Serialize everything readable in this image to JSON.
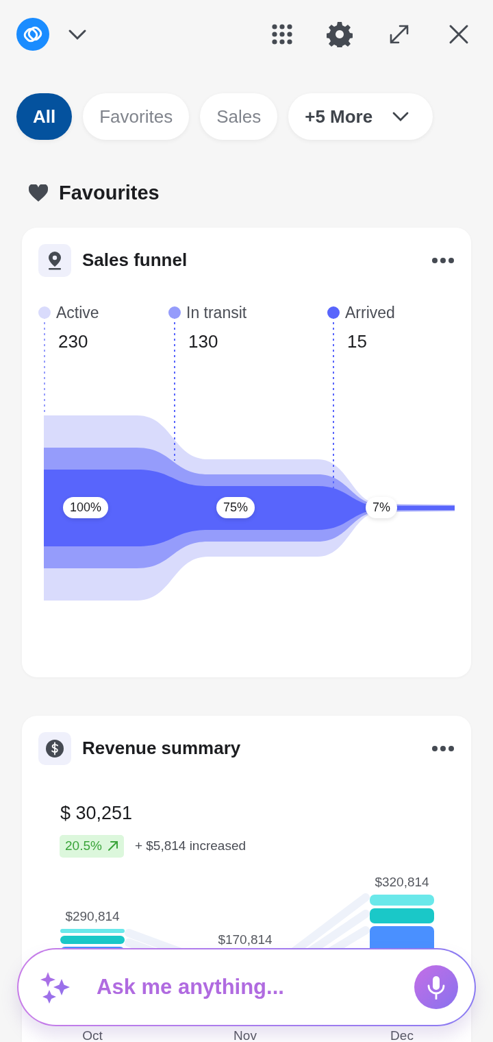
{
  "filters": [
    {
      "label": "All",
      "selected": true
    },
    {
      "label": "Favorites",
      "selected": false
    },
    {
      "label": "Sales",
      "selected": false
    },
    {
      "label": "+5 More",
      "selected": false,
      "kind": "dropdown"
    }
  ],
  "section": {
    "title": "Favourites"
  },
  "funnel_card": {
    "title": "Sales funnel",
    "stages": [
      {
        "label": "Active",
        "count": "230",
        "percent": "100%",
        "color": "#d9dbfc"
      },
      {
        "label": "In transit",
        "count": "130",
        "percent": "75%",
        "color": "#959cfb"
      },
      {
        "label": "Arrived",
        "count": "15",
        "percent": "7%",
        "color": "#5865fc"
      }
    ]
  },
  "revenue_card": {
    "title": "Revenue summary",
    "total": "$ 30,251",
    "change": "20.5%",
    "change_note": "+ $5,814 increased",
    "months": [
      {
        "label": "Oct",
        "total": "$290,814"
      },
      {
        "label": "Nov",
        "total": "$170,814"
      },
      {
        "label": "Dec",
        "total": "$320,814"
      }
    ]
  },
  "assistant": {
    "placeholder": "Ask me anything..."
  }
}
